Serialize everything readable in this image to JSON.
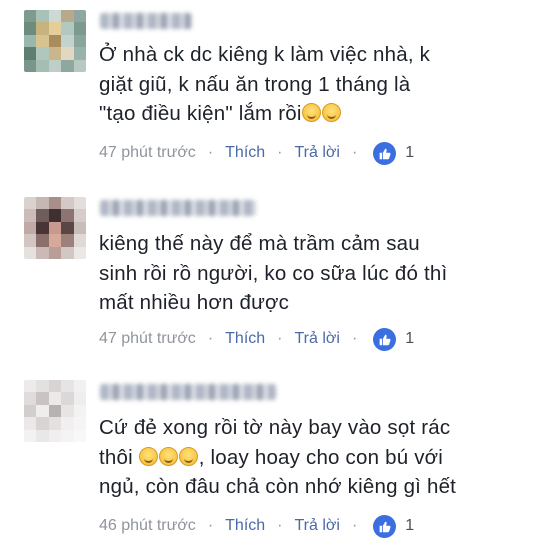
{
  "comments": [
    {
      "lines": [
        "Ở nhà ck dc  kiêng k làm việc nhà, k",
        "giặt giũ, k nấu ăn trong 1 tháng là",
        " \"tạo điều kiện\" lắm rồi"
      ],
      "emoji_count_last_line": 2,
      "time": "47 phút trước",
      "like_label": "Thích",
      "reply_label": "Trả lời",
      "reactions": "1"
    },
    {
      "lines": [
        "kiêng thế này để mà trầm cảm sau",
        "sinh rồi rồ người, ko co sữa lúc đó thì",
        "mất nhiều hơn được"
      ],
      "emoji_count_last_line": 0,
      "time": "47 phút trước",
      "like_label": "Thích",
      "reply_label": "Trả lời",
      "reactions": "1"
    },
    {
      "lines": [
        "Cứ đẻ xong rồi tờ này bay vào sọt rác",
        "thôi",
        ", loay hoay cho con bú với",
        "ngủ, còn đâu chả còn nhớ kiêng gì hết"
      ],
      "emoji_count_second_line": 3,
      "time": "46 phút trước",
      "like_label": "Thích",
      "reply_label": "Trả lời",
      "reactions": "1"
    }
  ],
  "colors": {
    "text": "#1d2129",
    "meta": "#90949c",
    "link": "#4b6aa6",
    "like_badge": "#3b6fe0"
  },
  "icons": {
    "reaction": "thumbs-up-icon",
    "emoji": "smiling-face-icon",
    "emoji_grin": "grinning-face-icon"
  }
}
